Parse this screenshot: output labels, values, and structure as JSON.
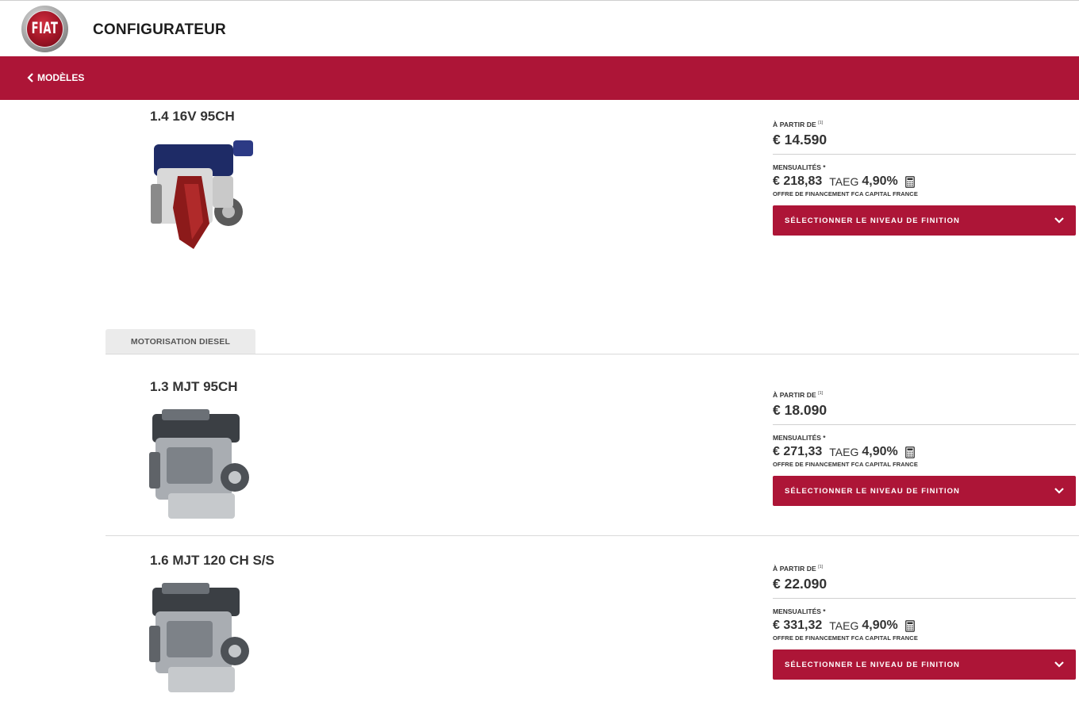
{
  "header": {
    "logo_text": "FIAT",
    "title": "CONFIGURATEUR"
  },
  "nav": {
    "back_label": "MODÈLES"
  },
  "diesel_tab_label": "MOTORISATION DIESEL",
  "engines": [
    {
      "name": "1.4 16V 95CH",
      "from_label": "À PARTIR DE",
      "from_note": "[1]",
      "price": "€ 14.590",
      "monthly_label": "MENSUALITÉS *",
      "monthly_value": "€ 218,83",
      "taeg_label": "TAEG",
      "taeg_value": "4,90%",
      "finance_offer": "OFFRE DE FINANCEMENT FCA CAPITAL FRANCE",
      "button_label": "SÉLECTIONNER LE NIVEAU DE FINITION"
    },
    {
      "name": "1.3 MJT 95CH",
      "from_label": "À PARTIR DE",
      "from_note": "[1]",
      "price": "€ 18.090",
      "monthly_label": "MENSUALITÉS *",
      "monthly_value": "€ 271,33",
      "taeg_label": "TAEG",
      "taeg_value": "4,90%",
      "finance_offer": "OFFRE DE FINANCEMENT FCA CAPITAL FRANCE",
      "button_label": "SÉLECTIONNER LE NIVEAU DE FINITION"
    },
    {
      "name": "1.6 MJT 120 CH S/S",
      "from_label": "À PARTIR DE",
      "from_note": "[1]",
      "price": "€ 22.090",
      "monthly_label": "MENSUALITÉS *",
      "monthly_value": "€ 331,32",
      "taeg_label": "TAEG",
      "taeg_value": "4,90%",
      "finance_offer": "OFFRE DE FINANCEMENT FCA CAPITAL FRANCE",
      "button_label": "SÉLECTIONNER LE NIVEAU DE FINITION"
    }
  ],
  "colors": {
    "brand_red": "#ad1537",
    "text_dark": "#333333"
  },
  "icons": {
    "back": "chevron-left-icon",
    "dropdown": "chevron-down-icon",
    "calculator": "calculator-icon"
  }
}
